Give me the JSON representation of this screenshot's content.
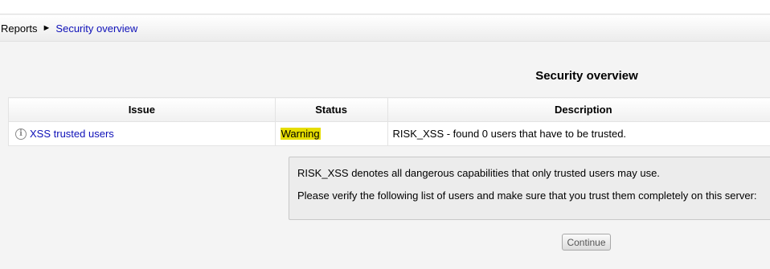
{
  "breadcrumb": {
    "root": "Reports",
    "separator": "►",
    "current": "Security overview"
  },
  "page_title": "Security overview",
  "table": {
    "headers": [
      "Issue",
      "Status",
      "Description"
    ],
    "rows": [
      {
        "issue": "XSS trusted users",
        "status": "Warning",
        "description": "RISK_XSS - found 0 users that have to be trusted."
      }
    ]
  },
  "details": {
    "line1": "RISK_XSS denotes all dangerous capabilities that only trusted users may use.",
    "line2": "Please verify the following list of users and make sure that you trust them completely on this server:"
  },
  "continue_label": "Continue",
  "colors": {
    "link": "#0e10b8",
    "warning_highlight": "#e6dd00",
    "details_background": "#ececec"
  },
  "icons": {
    "issue_info": "info-icon",
    "breadcrumb_separator": "arrow-right-icon"
  }
}
